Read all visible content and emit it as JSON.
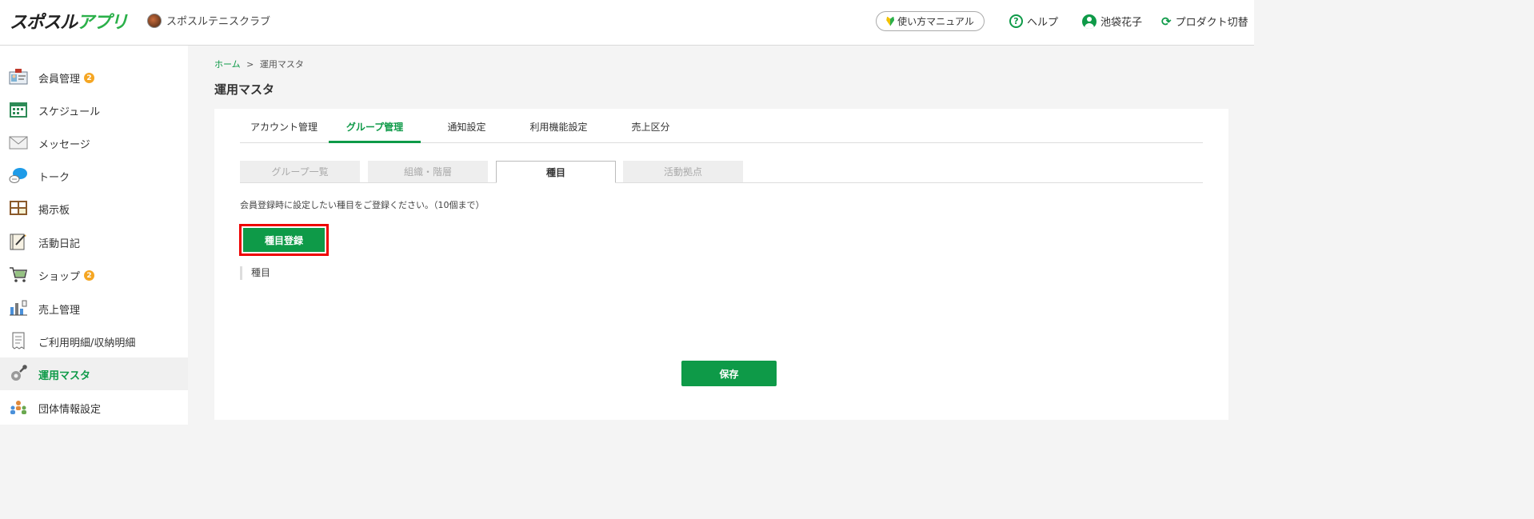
{
  "header": {
    "logo_main": "スポスル",
    "logo_accent": "アプリ",
    "club_name": "スポスルテニスクラブ",
    "manual_label": "使い方マニュアル",
    "help_label": "ヘルプ",
    "user_name": "池袋花子",
    "switch_label": "プロダクト切替",
    "help_glyph": "?",
    "switch_glyph": "⟳"
  },
  "sidebar": {
    "items": [
      {
        "label": "会員管理",
        "badge": "2",
        "icon": "member-card-icon"
      },
      {
        "label": "スケジュール",
        "icon": "calendar-icon"
      },
      {
        "label": "メッセージ",
        "icon": "envelope-icon"
      },
      {
        "label": "トーク",
        "icon": "chat-bubble-icon"
      },
      {
        "label": "掲示板",
        "icon": "bulletin-board-icon"
      },
      {
        "label": "活動日記",
        "icon": "diary-icon"
      },
      {
        "label": "ショップ",
        "badge": "2",
        "icon": "cart-icon"
      },
      {
        "label": "売上管理",
        "icon": "sales-chart-icon"
      },
      {
        "label": "ご利用明細/収納明細",
        "icon": "receipt-icon"
      },
      {
        "label": "運用マスタ",
        "icon": "gear-wrench-icon",
        "active": true
      },
      {
        "label": "団体情報設定",
        "icon": "group-icon"
      }
    ]
  },
  "breadcrumb": {
    "home": "ホーム",
    "separator": ">",
    "current": "運用マスタ"
  },
  "page_title": "運用マスタ",
  "tabs": [
    "アカウント管理",
    "グループ管理",
    "通知設定",
    "利用機能設定",
    "売上区分"
  ],
  "active_tab": "グループ管理",
  "subtabs": [
    "グループ一覧",
    "組織・階層",
    "種目",
    "活動拠点"
  ],
  "active_subtab": "種目",
  "description": "会員登録時に設定したい種目をご登録ください。（10個まで）",
  "register_button": "種目登録",
  "list_header": "種目",
  "save_button": "保存",
  "colors": {
    "accent": "#0e9a48",
    "badge": "#f5a623",
    "highlight": "#ee0000"
  }
}
